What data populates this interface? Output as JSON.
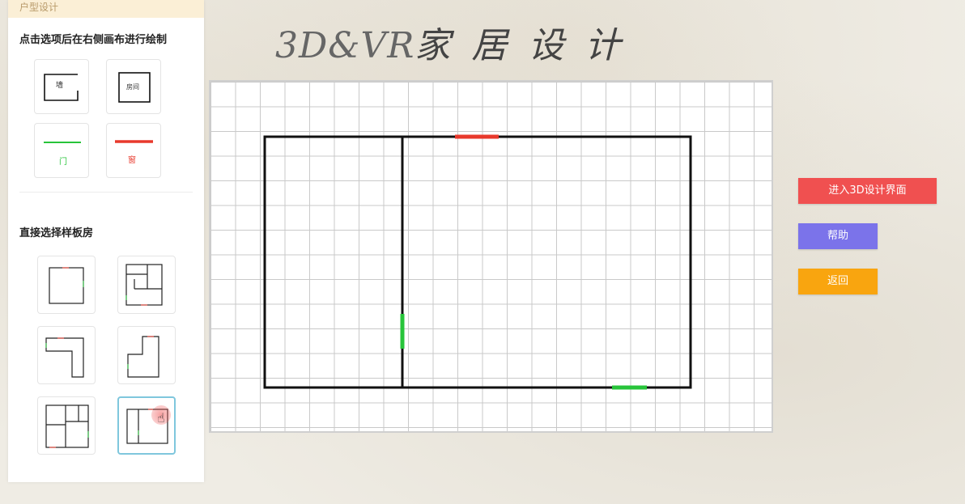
{
  "panel": {
    "header": "户型设计",
    "draw_section_title": "点击选项后在右侧画布进行绘制",
    "tools": [
      {
        "name": "wall",
        "label": "墙"
      },
      {
        "name": "room",
        "label": "房间"
      },
      {
        "name": "door",
        "label": "门"
      },
      {
        "name": "window",
        "label": "窗"
      }
    ],
    "template_section_title": "直接选择样板房",
    "templates": [
      "square",
      "multi-room",
      "l-shape",
      "step-shape",
      "four-room",
      "two-room"
    ],
    "selected_template": 5
  },
  "title": {
    "latin": "3D&VR",
    "cn": "家 居 设 计"
  },
  "buttons": {
    "enter_3d": "进入3D设计界面",
    "help": "帮助",
    "back": "返回"
  },
  "colors": {
    "red": "#f05050",
    "purple": "#7b73ea",
    "orange": "#f9a50f",
    "wall": "#111111",
    "window": "#e8392c",
    "door": "#27c43a"
  }
}
